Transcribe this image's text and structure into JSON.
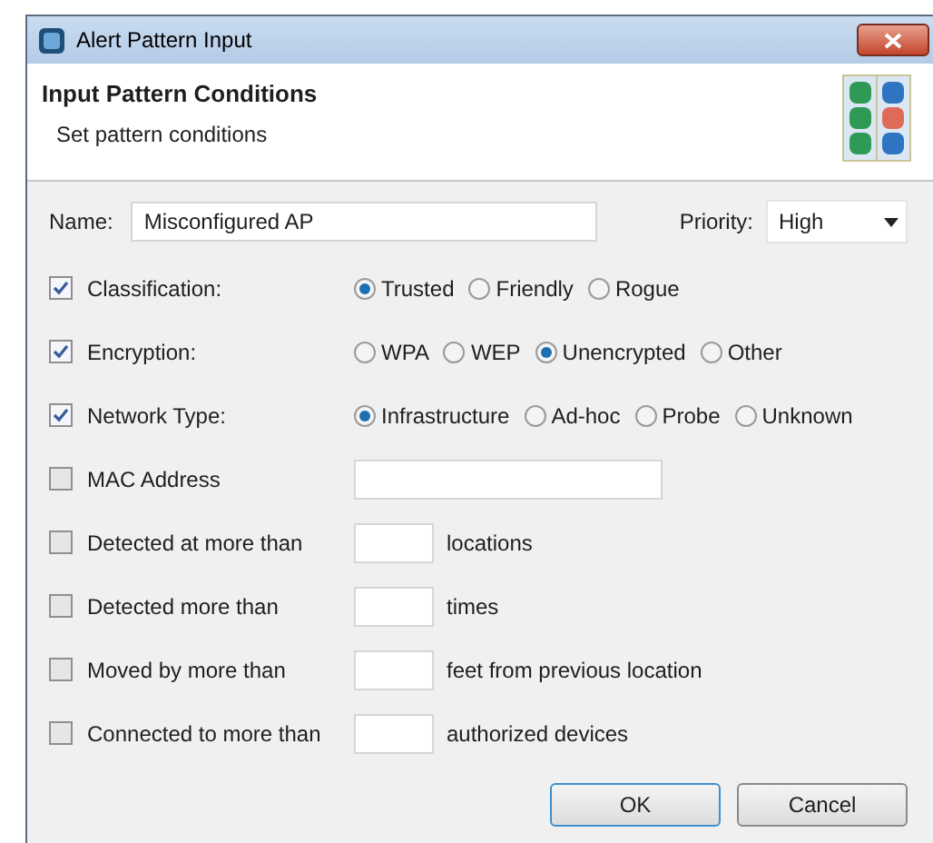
{
  "window": {
    "title": "Alert Pattern Input"
  },
  "header": {
    "title": "Input Pattern Conditions",
    "subtitle": "Set pattern conditions"
  },
  "name_field": {
    "label": "Name:",
    "value": "Misconfigured AP"
  },
  "priority": {
    "label": "Priority:",
    "value": "High"
  },
  "conditions": [
    {
      "kind": "choice",
      "label": "Classification:",
      "checked": true,
      "options": [
        {
          "label": "Trusted",
          "selected": true
        },
        {
          "label": "Friendly",
          "selected": false
        },
        {
          "label": "Rogue",
          "selected": false
        }
      ]
    },
    {
      "kind": "choice",
      "label": "Encryption:",
      "checked": true,
      "options": [
        {
          "label": "WPA",
          "selected": false
        },
        {
          "label": "WEP",
          "selected": false
        },
        {
          "label": "Unencrypted",
          "selected": true
        },
        {
          "label": "Other",
          "selected": false
        }
      ]
    },
    {
      "kind": "choice",
      "label": "Network Type:",
      "checked": true,
      "options": [
        {
          "label": "Infrastructure",
          "selected": true
        },
        {
          "label": "Ad-hoc",
          "selected": false
        },
        {
          "label": "Probe",
          "selected": false
        },
        {
          "label": "Unknown",
          "selected": false
        }
      ]
    },
    {
      "kind": "text",
      "label": "MAC Address",
      "checked": false
    },
    {
      "kind": "count",
      "label": "Detected at more than",
      "checked": false,
      "suffix": "locations"
    },
    {
      "kind": "count",
      "label": "Detected more than",
      "checked": false,
      "suffix": "times"
    },
    {
      "kind": "count",
      "label": "Moved by more than",
      "checked": false,
      "suffix": "feet from previous location"
    },
    {
      "kind": "count",
      "label": "Connected to more than",
      "checked": false,
      "suffix": "authorized devices"
    }
  ],
  "buttons": [
    "OK",
    "Cancel"
  ]
}
